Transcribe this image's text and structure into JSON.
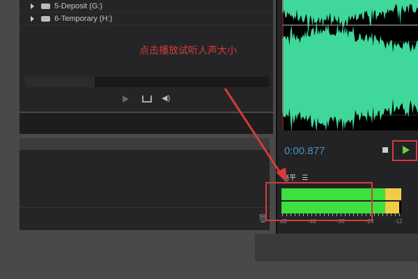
{
  "file_tree": {
    "items": [
      {
        "label": "5-Deposit (G:)"
      },
      {
        "label": "6-Temporary (H:)"
      }
    ]
  },
  "annotation": {
    "hint": "点击播放试听人声大小"
  },
  "transport": {
    "time": "0:00.877"
  },
  "level_meter": {
    "title": "电平",
    "menu_icon": "☰",
    "scale": [
      "dB",
      "-48",
      "-36",
      "-24",
      "-12"
    ],
    "channels": [
      {
        "green": 0.865,
        "yellow_end": 1.0
      },
      {
        "green": 0.865,
        "yellow_end": 0.98
      }
    ]
  },
  "colors": {
    "waveform": "#3fd89a",
    "annotation": "#d83a3a",
    "play": "#6ad12e",
    "time": "#4a8ec2"
  }
}
